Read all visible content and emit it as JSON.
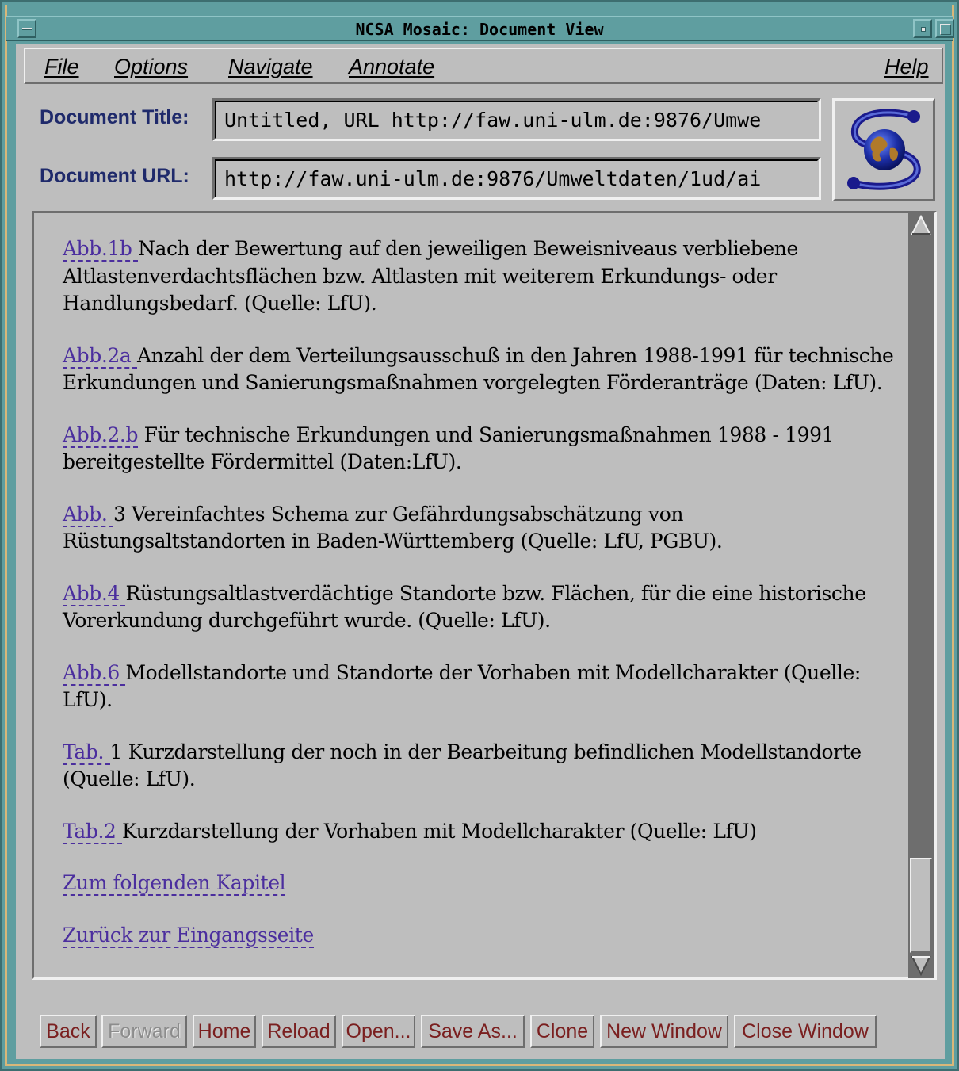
{
  "window": {
    "title": "NCSA Mosaic: Document View"
  },
  "menu": {
    "file": "File",
    "options": "Options",
    "navigate": "Navigate",
    "annotate": "Annotate",
    "help": "Help"
  },
  "fields": {
    "title_label": "Document Title:",
    "title_value": "Untitled, URL http://faw.uni-ulm.de:9876/Umwe",
    "url_label": "Document URL:",
    "url_value": "http://faw.uni-ulm.de:9876/Umweltdaten/1ud/ai"
  },
  "logo": {
    "icon": "mosaic-globe-logo"
  },
  "document": {
    "entries": [
      {
        "link": "Abb.1b ",
        "text": "Nach der Bewertung auf den jeweiligen Beweisniveaus verbliebene Altlastenverdachtsflächen bzw. Altlasten mit weiterem Erkundungs- oder Handlungsbedarf. (Quelle: LfU)."
      },
      {
        "link": "Abb.2a ",
        "text": "Anzahl der dem Verteilungsausschuß in den Jahren 1988-1991 für technische Erkundungen und Sanierungsmaßnahmen vorgelegten Förderanträge (Daten: LfU)."
      },
      {
        "link": "Abb.2.b",
        "text": " Für technische Erkundungen und Sanierungsmaßnahmen 1988 - 1991 bereitgestellte Fördermittel (Daten:LfU)."
      },
      {
        "link": "Abb. ",
        "text": "3 Vereinfachtes Schema zur Gefährdungsabschätzung von Rüstungsaltstandorten in Baden-Württemberg (Quelle: LfU, PGBU)."
      },
      {
        "link": "Abb.4 ",
        "text": "Rüstungsaltlastverdächtige Standorte bzw. Flächen, für die eine historische Vorerkundung durchgeführt wurde. (Quelle: LfU)."
      },
      {
        "link": "Abb.6 ",
        "text": "Modellstandorte und Standorte der Vorhaben mit Modellcharakter (Quelle: LfU)."
      },
      {
        "link": "Tab. ",
        "text": "1 Kurzdarstellung der noch in der Bearbeitung befindlichen Modellstandorte (Quelle: LfU)."
      },
      {
        "link": "Tab.2 ",
        "text": "Kurzdarstellung der Vorhaben mit Modellcharakter (Quelle: LfU)"
      }
    ],
    "nav_next": "Zum folgenden Kapitel ",
    "nav_back": "Zurück zur Eingangsseite "
  },
  "buttons": {
    "back": "Back",
    "forward": "Forward",
    "home": "Home",
    "reload": "Reload",
    "open": "Open...",
    "save_as": "Save As...",
    "clone": "Clone",
    "new_window": "New Window",
    "close_window": "Close Window"
  },
  "colors": {
    "frame": "#5f9ea0",
    "panel": "#bebebe",
    "link": "#4b2e9e",
    "label": "#1f2a6b",
    "button_text": "#7a1f1f"
  }
}
